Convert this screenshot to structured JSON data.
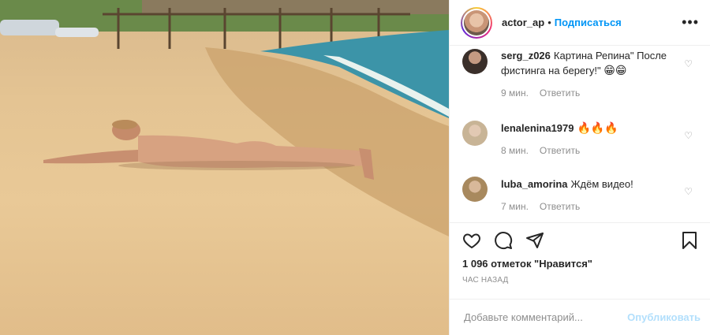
{
  "colors": {
    "accent": "#0095f6",
    "muted": "#8e8e8e",
    "publish_disabled": "#b2dffc"
  },
  "header": {
    "username": "actor_ap",
    "separator": "•",
    "follow_label": "Подписаться",
    "more_icon": "more-horizontal-icon"
  },
  "comments": [
    {
      "user": "serg_z026",
      "text": "Картина Репина\" После фистинга на берегу!\"",
      "emoji": "😁😁",
      "time": "9 мин.",
      "reply": "Ответить"
    },
    {
      "user": "lenalenina1979",
      "text": "",
      "emoji": "🔥🔥🔥",
      "time": "8 мин.",
      "reply": "Ответить"
    },
    {
      "user": "luba_amorina",
      "text": "Ждём видео!",
      "emoji": "",
      "time": "7 мин.",
      "reply": "Ответить"
    }
  ],
  "actions": {
    "like_icon": "heart-icon",
    "comment_icon": "comment-icon",
    "share_icon": "share-icon",
    "save_icon": "bookmark-icon",
    "likes_text": "1 096 отметок \"Нравится\"",
    "time_ago": "ЧАС НАЗАД"
  },
  "add_comment": {
    "placeholder": "Добавьте комментарий...",
    "publish_label": "Опубликовать"
  }
}
